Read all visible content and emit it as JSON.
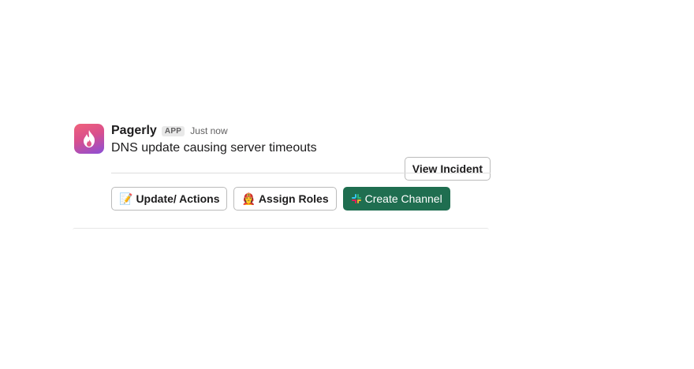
{
  "message": {
    "sender": "Pagerly",
    "badge": "APP",
    "timestamp": "Just now",
    "text": "DNS update causing server timeouts",
    "accessory_button": "View Incident"
  },
  "actions": [
    {
      "label": "Update/ Actions",
      "icon": "memo-icon"
    },
    {
      "label": "Assign Roles",
      "icon": "person-icon"
    },
    {
      "label": "Create Channel",
      "icon": "slack-icon"
    }
  ],
  "colors": {
    "primary_button": "#1f6e50",
    "avatar_gradient_start": "#f0627a",
    "avatar_gradient_end": "#8a4fd8"
  }
}
